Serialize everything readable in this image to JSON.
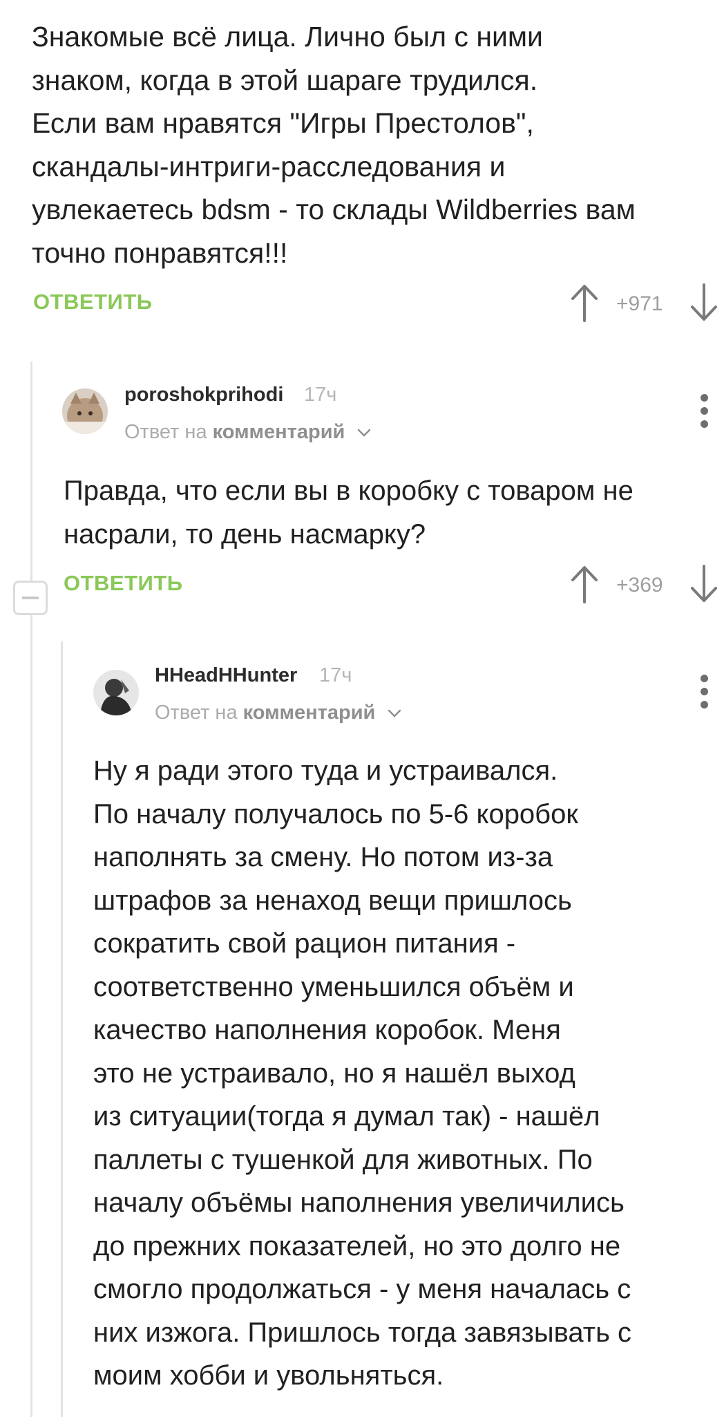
{
  "top_comment": {
    "lines": [
      "Знакомые всё лица. Лично был с ними",
      "знаком, когда в этой шараге трудился.",
      "Если вам нравятся \"Игры Престолов\",",
      "скандалы-интриги-расследования и",
      "увлекаетесь bdsm - то склады Wildberries вам",
      "точно понравятся!!!"
    ],
    "reply_label": "ОТВЕТИТЬ",
    "votes": "+971"
  },
  "reply1": {
    "username": "poroshokprihodi",
    "time": "17ч",
    "reply_to_prefix": "Ответ на",
    "reply_to_target": "комментарий",
    "lines": [
      "Правда, что если вы в коробку с товаром не",
      "насрали, то день насмарку?"
    ],
    "reply_label": "ОТВЕТИТЬ",
    "votes": "+369"
  },
  "reply2": {
    "username": "HHeadHHunter",
    "time": "17ч",
    "reply_to_prefix": "Ответ на",
    "reply_to_target": "комментарий",
    "lines": [
      "Ну я ради этого туда и устраивался.",
      "По началу получалось по 5-6 коробок",
      "наполнять за смену. Но потом из-за",
      "штрафов за ненаход вещи пришлось",
      "сократить свой рацион питания -",
      "соответственно уменьшился объём и",
      "качество наполнения коробок. Меня",
      "это не устраивало, но я нашёл выход",
      "из ситуации(тогда я думал так) - нашёл",
      "паллеты с тушенкой для животных. По",
      "началу объёмы наполнения увеличились",
      "до прежних показателей, но это долго не",
      "смогло продолжаться - у меня началась с",
      "них изжога. Пришлось тогда завязывать с",
      "моим хобби и увольняться."
    ]
  },
  "colors": {
    "reply_green": "#8ac858",
    "text": "#212121",
    "muted": "#9e9e9e",
    "thread_line": "#e3e3e3"
  },
  "icons": [
    "arrow-up-icon",
    "arrow-down-icon",
    "more-vertical-icon",
    "chevron-down-icon",
    "collapse-minus-icon"
  ]
}
